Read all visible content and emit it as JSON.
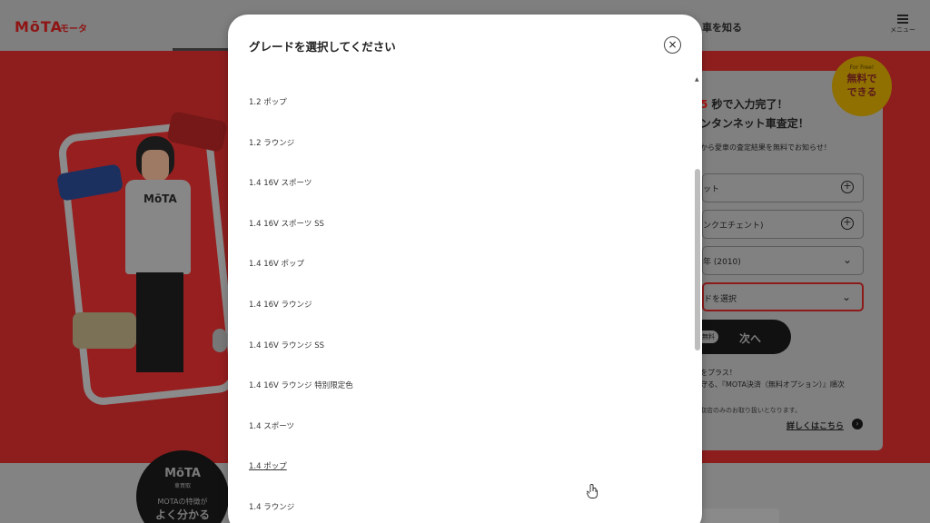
{
  "header": {
    "logo": "MōTA",
    "logo_sub": "モータ",
    "nav_know": "車を知る",
    "menu_label": "メニュー"
  },
  "hero": {
    "shirt_text": "MōTA"
  },
  "form": {
    "badge_en": "For Free!",
    "badge_jp_line1": "無料で",
    "badge_jp_line2": "できる",
    "title_num": "5",
    "title_line1": "秒で入力完了！",
    "title_line2": "ンタンネット車査定！",
    "desc": "から愛車の査定結果を無料でお知らせ！",
    "field1": "ット",
    "field2": "ンクエチェント)",
    "field3": "年 (2010)",
    "field4": "ドを選択",
    "next_free": "無料",
    "next_label": "次へ",
    "option_line1": "゚をプラス！",
    "option_line2": "守る、『MOTA決済（無料オプション）』順次",
    "option_line3": "取店のみのお取り扱いとなります。",
    "details_link": "詳しくはこちら",
    "details_arrow": "›"
  },
  "bottom_badge": {
    "logo": "MōTA",
    "sub": "車買取",
    "line1": "MOTAの特徴が",
    "line2": "よく分かる"
  },
  "modal": {
    "title": "グレードを選択してください",
    "close_glyph": "×",
    "scroll_up_glyph": "▲",
    "grades": [
      "1.2 ポップ",
      "1.2 ラウンジ",
      "1.4 16V スポーツ",
      "1.4 16V スポーツ SS",
      "1.4 16V ポップ",
      "1.4 16V ラウンジ",
      "1.4 16V ラウンジ SS",
      "1.4 16V ラウンジ 特別限定色",
      "1.4 スポーツ",
      "1.4 ポップ",
      "1.4 ラウンジ"
    ],
    "hovered_grade_index": 9
  },
  "icons": {
    "close": "close-icon",
    "plus": "plus-circle-icon",
    "chevron": "chevron-down-icon",
    "menu": "hamburger-menu-icon",
    "cursor": "hand-pointer-icon"
  }
}
